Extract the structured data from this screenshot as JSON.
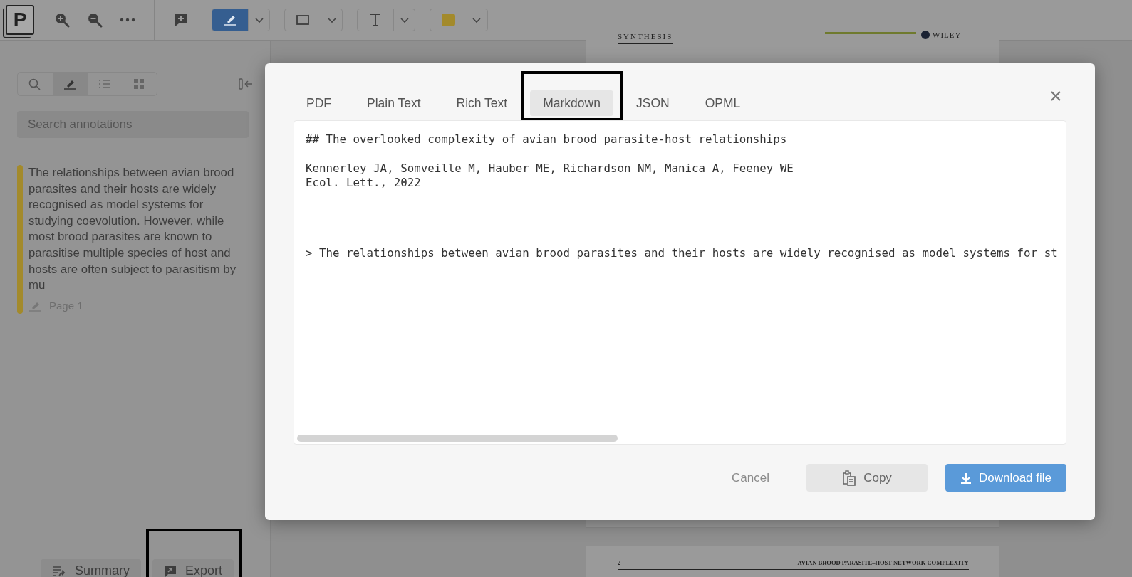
{
  "toolbar": {
    "logo": "P",
    "tools": [
      {
        "kind": "zoom-in"
      },
      {
        "kind": "zoom-out"
      },
      {
        "kind": "more"
      },
      {
        "kind": "comment"
      },
      {
        "kind": "highlight",
        "selected": true
      },
      {
        "kind": "rect",
        "selected": false
      },
      {
        "kind": "text",
        "selected": false
      },
      {
        "kind": "color",
        "selected": false,
        "color": "#a38a2b"
      }
    ]
  },
  "sidebar": {
    "tabs": [
      {
        "kind": "search",
        "selected": false
      },
      {
        "kind": "annotations",
        "selected": true
      },
      {
        "kind": "outline",
        "selected": false
      },
      {
        "kind": "thumbnails",
        "selected": false
      }
    ],
    "search": {
      "placeholder": "Search annotations"
    },
    "annotations": [
      {
        "text": "The relationships between avian brood parasites and their hosts are widely recognised as model systems for studying coevolution. However, while most brood parasites are known to parasitise multiple species of host and hosts are often subject to parasitism by mu",
        "page": "Page 1",
        "color": "#a38a2b"
      }
    ],
    "footer_buttons": [
      {
        "label": "Summary",
        "kind": "summary"
      },
      {
        "label": "Export",
        "kind": "export",
        "highlighted": true
      }
    ]
  },
  "document": {
    "page_1": {
      "journal": "SYNTHESIS",
      "publisher": "WILEY"
    },
    "page_2": {
      "page_number": "2",
      "running_head": "AVIAN BROOD PARASITE–HOST NETWORK COMPLEXITY"
    }
  },
  "dialog": {
    "tabs": [
      {
        "label": "PDF",
        "selected": false,
        "highlighted": false
      },
      {
        "label": "Plain Text",
        "selected": false,
        "highlighted": false
      },
      {
        "label": "Rich Text",
        "selected": false,
        "highlighted": false
      },
      {
        "label": "Markdown",
        "selected": true,
        "highlighted": true
      },
      {
        "label": "JSON",
        "selected": false,
        "highlighted": false
      },
      {
        "label": "OPML",
        "selected": false,
        "highlighted": false
      }
    ],
    "content_blocks": [
      {
        "kind": "heading",
        "lines": [
          "## The overlooked complexity of avian brood parasite-host relationships"
        ]
      },
      {
        "kind": "meta",
        "lines": [
          "Kennerley JA, Somveille M, Hauber ME, Richardson NM, Manica A, Feeney WE",
          "Ecol. Lett., 2022"
        ]
      },
      {
        "kind": "quote",
        "lines": [
          "> The relationships between avian brood parasites and their hosts are widely recognised as model systems for st"
        ]
      }
    ],
    "buttons": [
      {
        "label": "Cancel",
        "kind": "link"
      },
      {
        "label": "Copy",
        "kind": "copy"
      },
      {
        "label": "Download file",
        "kind": "download"
      }
    ]
  }
}
